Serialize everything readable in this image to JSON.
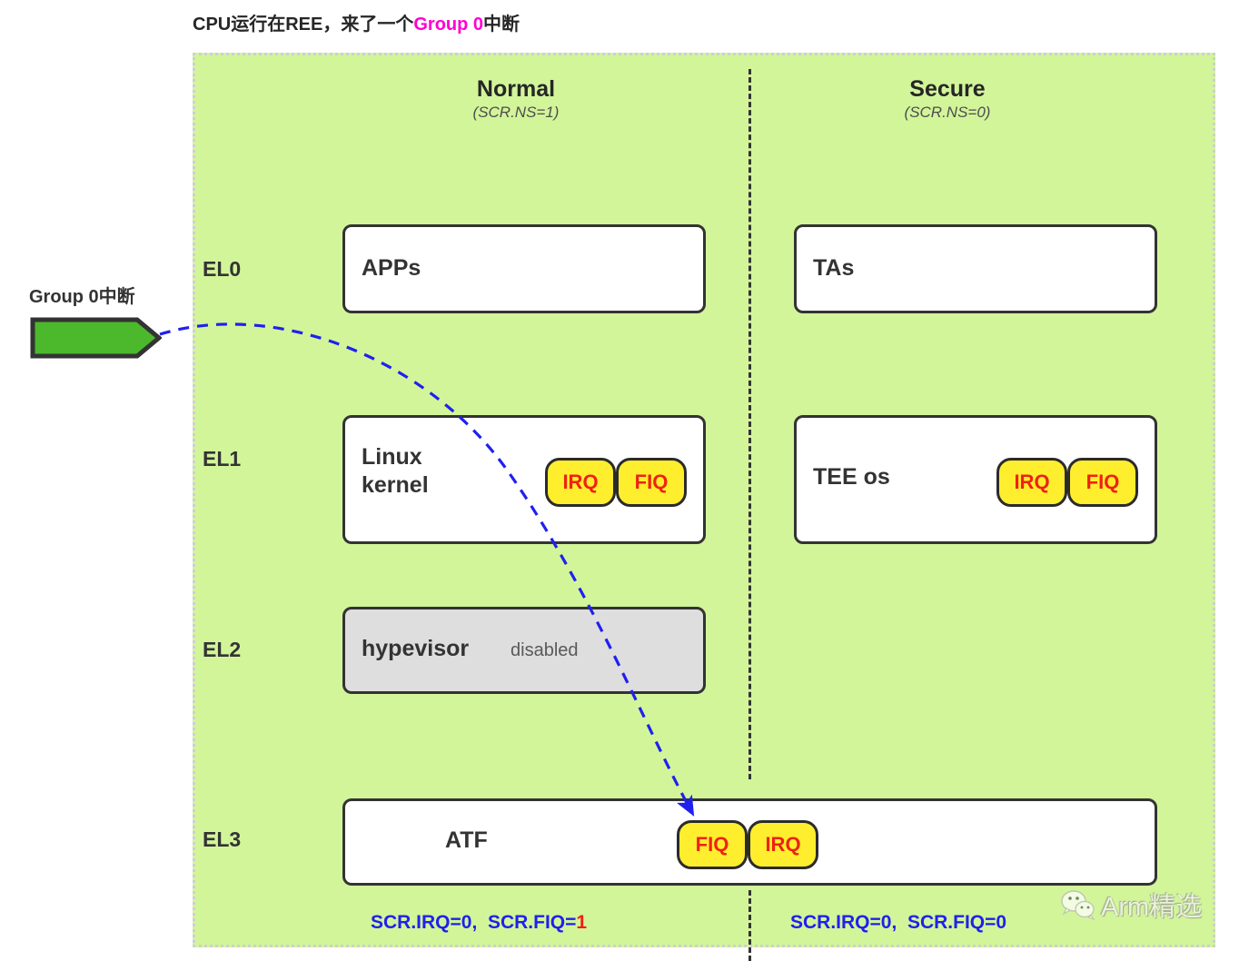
{
  "title": {
    "prefix": "CPU运行在REE，来了一个",
    "accent": "Group 0",
    "suffix": "中断",
    "accent_color": "#ff00d0"
  },
  "incoming": {
    "label": "Group 0中断",
    "arrow_color": "#4cb82c",
    "icon": "block-arrow-right-icon"
  },
  "worlds": [
    {
      "name": "Normal",
      "scr": "(SCR.NS=1)"
    },
    {
      "name": "Secure",
      "scr": "(SCR.NS=0)"
    }
  ],
  "levels": [
    {
      "label": "EL0"
    },
    {
      "label": "EL1"
    },
    {
      "label": "EL2"
    },
    {
      "label": "EL3"
    }
  ],
  "boxes": {
    "apps": {
      "label": "APPs"
    },
    "tas": {
      "label": "TAs"
    },
    "linux": {
      "label": "Linux\nkernel"
    },
    "tee": {
      "label": "TEE os"
    },
    "hypevisor": {
      "label": "hypevisor",
      "note": "disabled"
    },
    "atf": {
      "label": "ATF"
    }
  },
  "badges": {
    "linux": [
      "IRQ",
      "FIQ"
    ],
    "tee": [
      "IRQ",
      "FIQ"
    ],
    "atf": [
      "FIQ",
      "IRQ"
    ],
    "fill": "#ffee2e",
    "text_color": "#ee2211"
  },
  "status": {
    "normal": {
      "irq": "SCR.IRQ=0,",
      "fiq_prefix": "SCR.FIQ=",
      "fiq_value": "1",
      "highlight": true
    },
    "secure": {
      "irq": "SCR.IRQ=0,",
      "fiq_prefix": "SCR.FIQ=",
      "fiq_value": "0",
      "highlight": false
    },
    "color": "#2020ee",
    "highlight_color": "#ee2211"
  },
  "flow": {
    "color": "#2020ee",
    "style": "dashed-curve",
    "from": "group-0-interrupt-arrow",
    "to": "atf-fiq-badge"
  },
  "watermark": {
    "icon": "wechat-icon",
    "text": "Arm精选"
  }
}
